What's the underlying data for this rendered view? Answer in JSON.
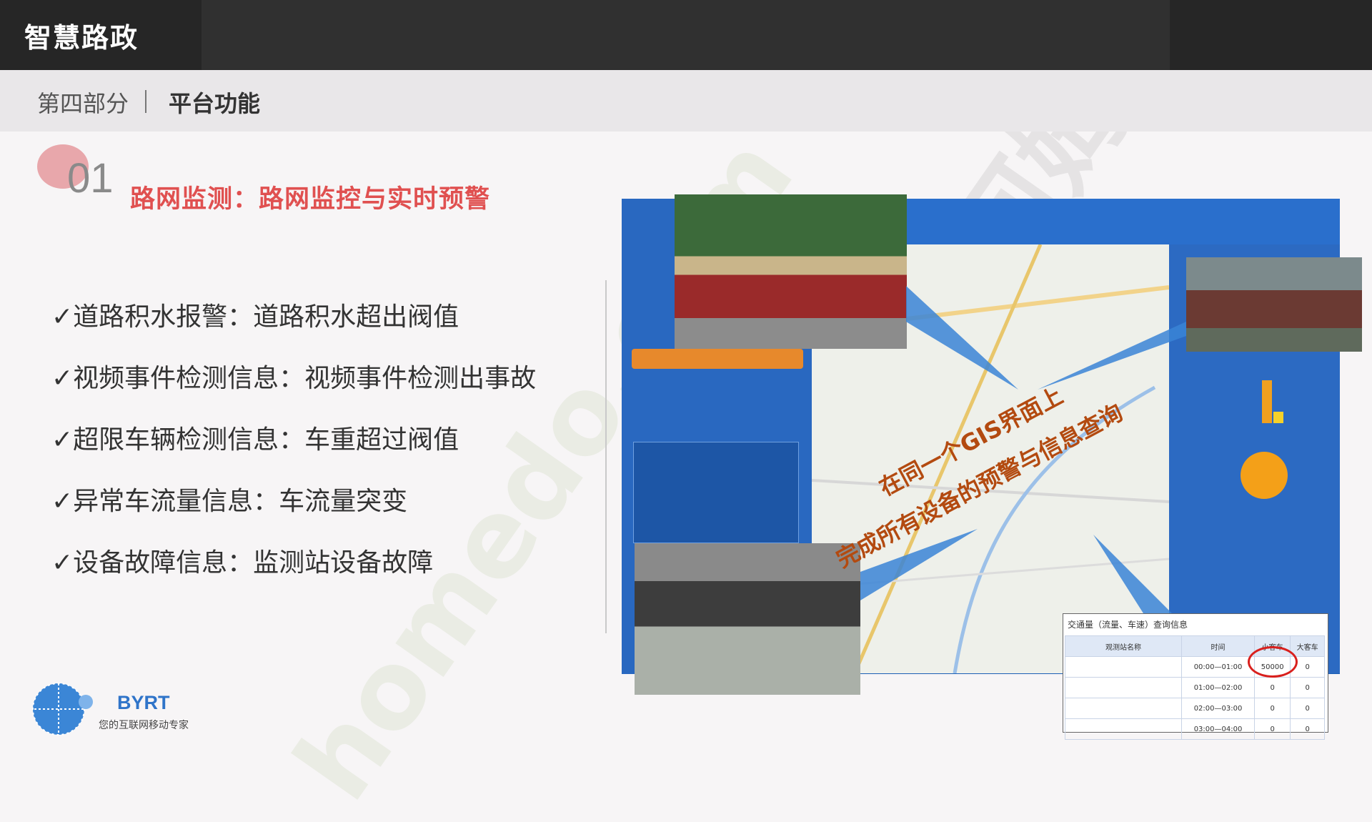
{
  "header": {
    "title": "智慧路政"
  },
  "subheader": {
    "part": "第四部分",
    "function": "平台功能"
  },
  "section": {
    "number": "01",
    "title": "路网监测：路网监控与实时预警"
  },
  "items": [
    "✓道路积水报警：道路积水超出阀值",
    "✓视频事件检测信息：视频事件检测出事故",
    "✓超限车辆检测信息：车重超过阀值",
    "✓异常车流量信息：车流量突变",
    "✓设备故障信息：监测站设备故障"
  ],
  "annotations": {
    "line1": "在同一个GIS界面上",
    "line2": "完成所有设备的预警与信息查询"
  },
  "query_box": {
    "title": "交通量（流量、车速）查询信息",
    "headers": [
      "观测站名称",
      "时间",
      "小客车",
      "大客车"
    ],
    "rows": [
      [
        "",
        "00:00—01:00",
        "50000",
        "0"
      ],
      [
        "",
        "01:00—02:00",
        "0",
        "0"
      ],
      [
        "",
        "02:00—03:00",
        "0",
        "0"
      ],
      [
        "",
        "03:00—04:00",
        "0",
        "0"
      ]
    ]
  },
  "logo": {
    "name": "BYRT",
    "slogan": "您的互联网移动专家"
  },
  "watermark": {
    "text1": "homedo.com",
    "text2": "河姆渡"
  },
  "colors": {
    "accent": "#e05050",
    "brand": "#2f74c9"
  }
}
